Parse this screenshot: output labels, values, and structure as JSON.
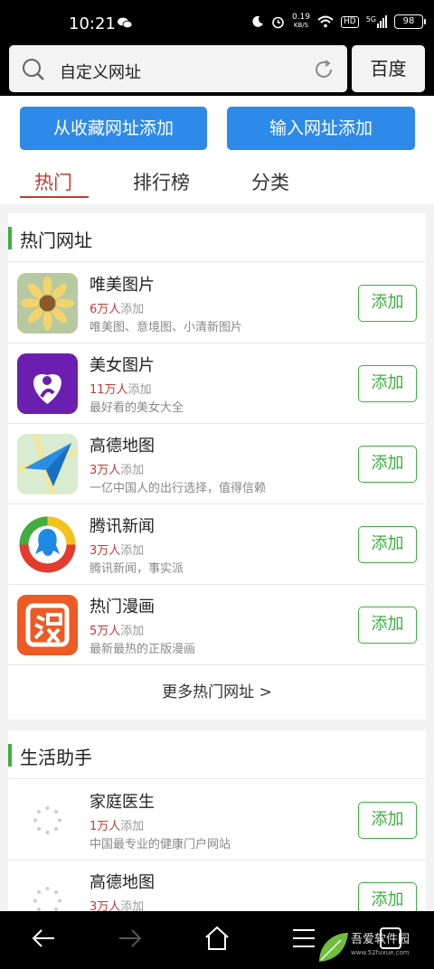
{
  "status": {
    "time": "10:21",
    "net_speed": "0.19",
    "net_unit": "KB/S",
    "hd": "HD",
    "signal": "5G",
    "battery": "98"
  },
  "search": {
    "text": "自定义网址",
    "engine": "百度"
  },
  "actions": {
    "fav": "从收藏网址添加",
    "url": "输入网址添加"
  },
  "tabs": [
    "热门",
    "排行榜",
    "分类"
  ],
  "section1": {
    "title": "热门网址",
    "add_label": "添加",
    "count_suffix": "添加",
    "items": [
      {
        "name": "唯美图片",
        "count": "6万人",
        "desc": "唯美图、意境图、小清新图片",
        "icon": "sunflower-icon"
      },
      {
        "name": "美女图片",
        "count": "11万人",
        "desc": "最好看的美女大全",
        "icon": "beauty-icon"
      },
      {
        "name": "高德地图",
        "count": "3万人",
        "desc": "一亿中国人的出行选择，值得信赖",
        "icon": "amap-icon"
      },
      {
        "name": "腾讯新闻",
        "count": "3万人",
        "desc": "腾讯新闻，事实派",
        "icon": "tencent-news-icon"
      },
      {
        "name": "热门漫画",
        "count": "5万人",
        "desc": "最新最热的正版漫画",
        "icon": "manga-icon"
      }
    ],
    "more": "更多热门网址 >"
  },
  "section2": {
    "title": "生活助手",
    "add_label": "添加",
    "count_suffix": "添加",
    "items": [
      {
        "name": "家庭医生",
        "count": "1万人",
        "desc": "中国最专业的健康门户网站",
        "icon": "loading-icon"
      },
      {
        "name": "高德地图",
        "count": "3万人",
        "desc": "",
        "icon": "loading-icon"
      }
    ]
  },
  "watermark": {
    "name": "吾爱软件园",
    "url": "www.52fuxue.com"
  },
  "colors": {
    "accent_blue": "#2d8ae8",
    "green": "#3fae3f",
    "red": "#c33b2f"
  }
}
